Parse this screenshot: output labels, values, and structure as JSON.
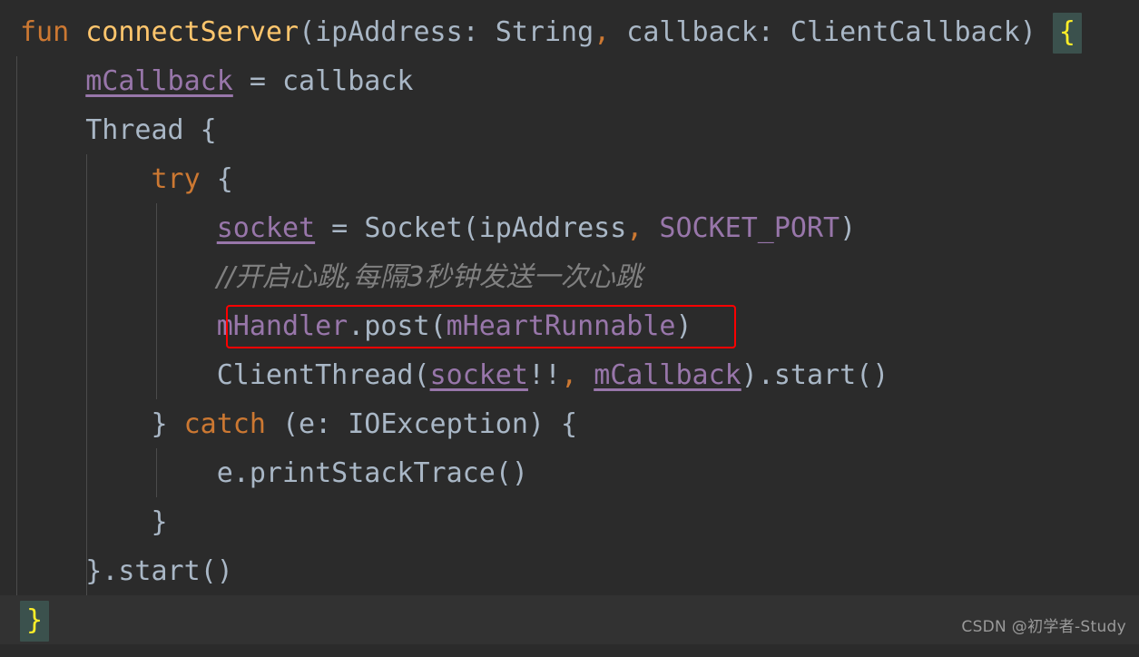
{
  "editor": {
    "background_color": "#2b2b2b",
    "current_line_color": "#323232",
    "default_text_color": "#a9b7c6",
    "indent_guide_color": "#4b4b4b",
    "brace_match_bg": "#3b514d",
    "brace_match_fg": "#ffef28",
    "annotation_color": "#fe0000"
  },
  "code": {
    "line1": {
      "kw_fun": "fun",
      "space1": " ",
      "name": "connectServer",
      "paren_open": "(",
      "param1": "ipAddress: String",
      "comma1": ",",
      "space2": " ",
      "param2": "callback: ClientCallback",
      "paren_close": ")",
      "space3": " ",
      "brace": "{"
    },
    "line2": {
      "indent": "    ",
      "field": "mCallback",
      "assign": " = ",
      "value": "callback"
    },
    "line3": {
      "indent": "    ",
      "type": "Thread",
      "brace": " {"
    },
    "line4": {
      "indent": "        ",
      "kw_try": "try",
      "brace": " {"
    },
    "line5": {
      "indent": "            ",
      "field": "socket",
      "assign": " = ",
      "ctor": "Socket(ipAddress",
      "comma": ",",
      "space": " ",
      "constant": "SOCKET_PORT",
      "paren_close": ")"
    },
    "line6": {
      "indent": "            ",
      "comment": "//开启心跳,每隔3秒钟发送一次心跳"
    },
    "line7": {
      "indent": "            ",
      "receiver": "mHandler",
      "dot_method": ".post",
      "paren_open": "(",
      "argument": "mHeartRunnable",
      "paren_close": ")"
    },
    "line8": {
      "indent": "            ",
      "ctor": "ClientThread",
      "paren_open": "(",
      "arg1": "socket",
      "bangs": "!!",
      "comma": ",",
      "space": " ",
      "arg2": "mCallback",
      "paren_close": ")",
      "tail": ".start()"
    },
    "line9": {
      "indent": "        ",
      "brace_close": "} ",
      "kw_catch": "catch",
      "params": " (e: IOException) ",
      "brace_open": "{"
    },
    "line10": {
      "indent": "            ",
      "call": "e.printStackTrace()"
    },
    "line11": {
      "indent": "        ",
      "brace_close": "}"
    },
    "line12": {
      "indent": "    ",
      "brace_close": "}",
      "tail": ".start()"
    },
    "line13": {
      "brace": "}"
    }
  },
  "watermark": {
    "text": "CSDN @初学者-Study"
  }
}
